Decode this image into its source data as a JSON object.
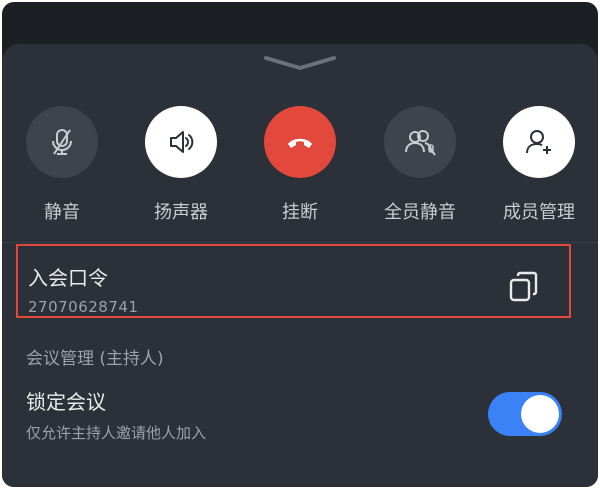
{
  "controls": [
    {
      "label": "静音",
      "icon": "mic-muted-icon"
    },
    {
      "label": "扬声器",
      "icon": "speaker-icon"
    },
    {
      "label": "挂断",
      "icon": "hang-up-icon"
    },
    {
      "label": "全员静音",
      "icon": "mute-all-icon"
    },
    {
      "label": "成员管理",
      "icon": "add-member-icon"
    }
  ],
  "meeting_code": {
    "title": "入会口令",
    "value": "27070628741",
    "copy_icon": "copy-icon"
  },
  "host_section": {
    "title": "会议管理 (主持人)",
    "lock": {
      "title": "锁定会议",
      "description": "仅允许主持人邀请他人加入",
      "enabled": true
    }
  },
  "colors": {
    "accent_red": "#e2483b",
    "toggle_blue": "#3b82f6",
    "sheet_bg": "#2c3038"
  }
}
